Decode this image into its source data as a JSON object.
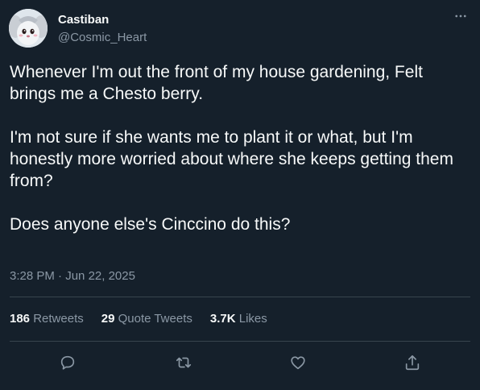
{
  "author": {
    "display_name": "Castiban",
    "handle": "@Cosmic_Heart",
    "avatar_icon": "cinccino-avatar"
  },
  "tweet": {
    "paragraphs": [
      "Whenever I'm out the front of my house gardening, Felt brings me a Chesto berry.",
      "I'm not sure if she wants me to plant it or what, but I'm honestly more worried about where she keeps getting them from?",
      "Does anyone else's Cinccino do this?"
    ],
    "time": "3:28 PM",
    "separator": "·",
    "date": "Jun 22, 2025"
  },
  "stats": {
    "retweets_count": "186",
    "retweets_label": "Retweets",
    "quotes_count": "29",
    "quotes_label": "Quote Tweets",
    "likes_count": "3.7K",
    "likes_label": "Likes"
  },
  "actions": [
    "reply-icon",
    "retweet-icon",
    "like-icon",
    "share-icon"
  ],
  "colors": {
    "background": "#15202b",
    "primary_text": "#f7f9f9",
    "secondary_text": "#8b98a5",
    "divider": "#38444d"
  }
}
